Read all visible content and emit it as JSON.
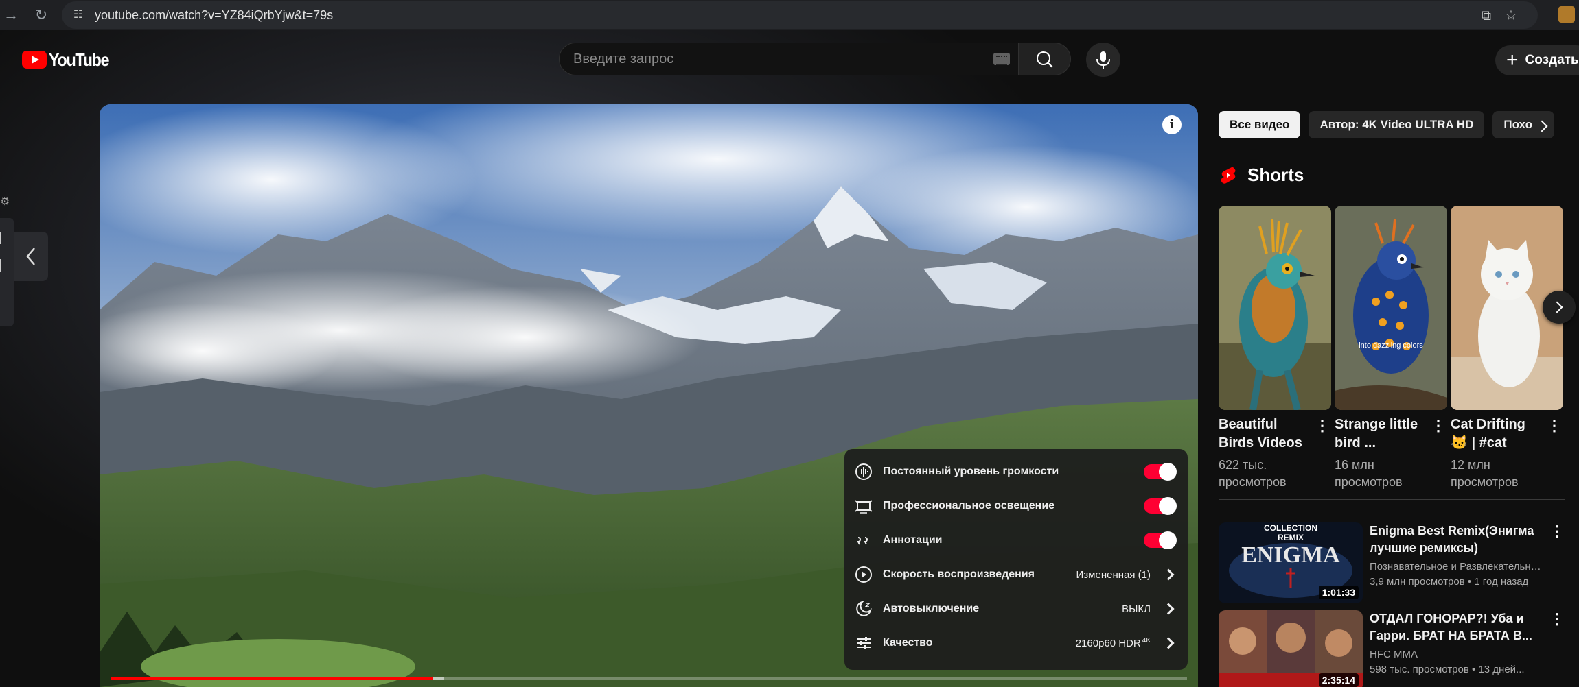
{
  "browser": {
    "url": "youtube.com/watch?v=YZ84iQrbYjw&t=79s"
  },
  "masthead": {
    "logo_text": "YouTube",
    "search_placeholder": "Введите запрос",
    "create_label": "Создать"
  },
  "player": {
    "progress_played_fraction": 0.3,
    "progress_loaded_fraction": 0.31
  },
  "settings_menu": {
    "items": [
      {
        "label": "Постоянный уровень громкости",
        "type": "toggle",
        "on": true,
        "icon": "stable-volume-icon"
      },
      {
        "label": "Профессиональное освещение",
        "type": "toggle",
        "on": true,
        "icon": "ambient-mode-icon"
      },
      {
        "label": "Аннотации",
        "type": "toggle",
        "on": true,
        "icon": "annotations-icon"
      },
      {
        "label": "Скорость воспроизведения",
        "type": "submenu",
        "value": "Измененная (1)",
        "icon": "playback-speed-icon"
      },
      {
        "label": "Автовыключение",
        "type": "submenu",
        "value": "ВЫКЛ",
        "icon": "sleep-timer-icon"
      },
      {
        "label": "Качество",
        "type": "submenu",
        "value": "2160p60 HDR",
        "badge": "4K",
        "icon": "quality-icon"
      }
    ]
  },
  "chips": [
    "Все видео",
    "Автор: 4K Video ULTRA HD",
    "Похо"
  ],
  "shorts": {
    "title": "Shorts",
    "items": [
      {
        "title": "Beautiful Birds Videos",
        "views": "622 тыс. просмотров"
      },
      {
        "title": "Strange little bird ...",
        "views": "16 млн просмотров",
        "overlay_text": "into dazzling colors"
      },
      {
        "title": "Cat Drifting 🐱 | #cat",
        "views": "12 млн просмотров"
      }
    ]
  },
  "videos": [
    {
      "title": "Enigma Best Remix(Энигма лучшие ремиксы)",
      "channel": "Познавательное и Развлекательное",
      "views": "3,9 млн просмотров",
      "age": "1 год назад",
      "duration": "1:01:33",
      "thumb_text": {
        "top": "COLLECTION",
        "mid": "REMIX",
        "main": "ENIGMA"
      }
    },
    {
      "title": "ОТДАЛ ГОНОРАР?! Уба и Гарри. БРАТ НА БРАТА В...",
      "channel": "HFC MMA",
      "views": "598 тыс. просмотров",
      "age": "13 дней...",
      "duration": "2:35:14"
    }
  ],
  "colors": {
    "accent_red": "#ff0000",
    "toggle_on": "#ff0033",
    "background": "#0f0f0f"
  }
}
